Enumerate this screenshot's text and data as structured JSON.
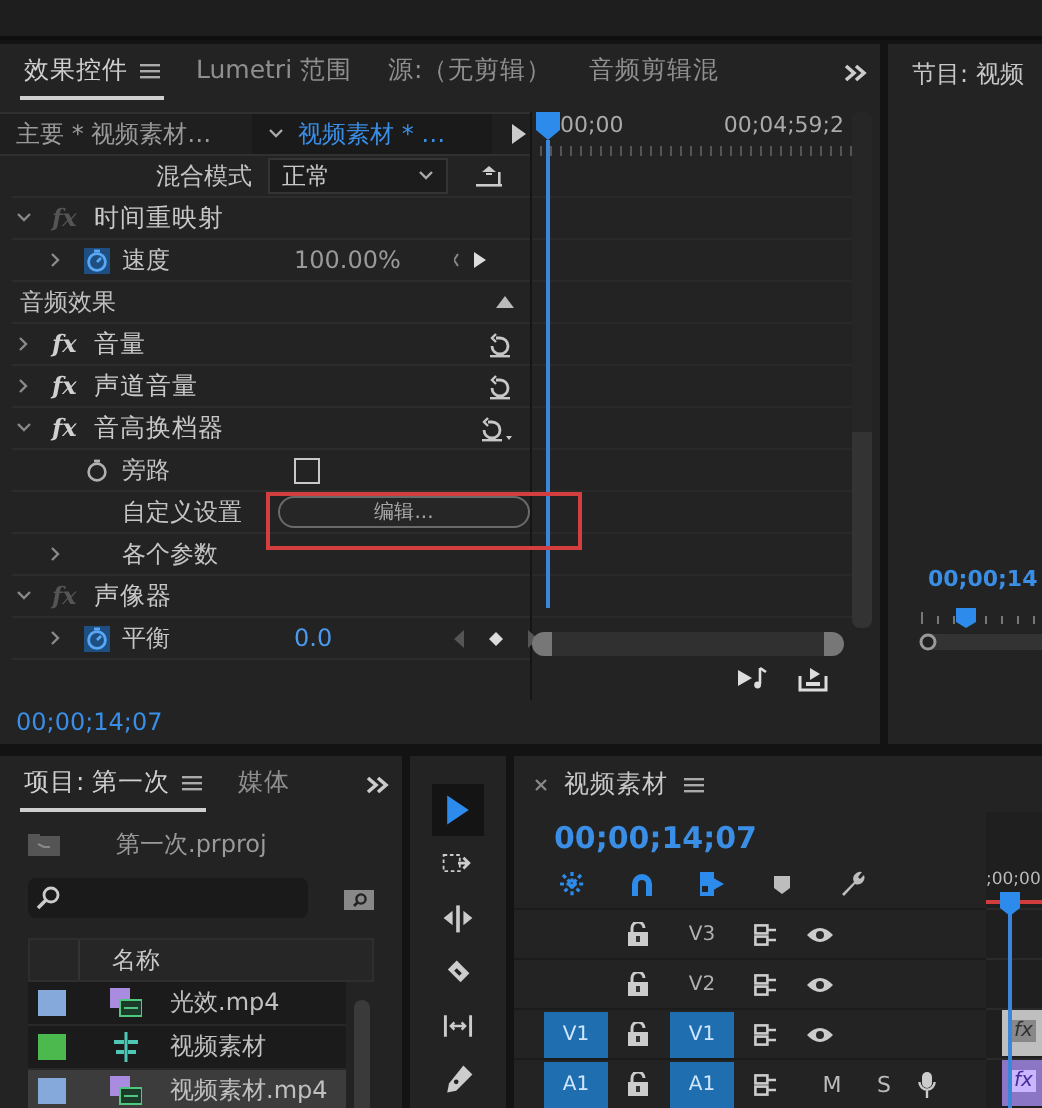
{
  "effect_controls": {
    "tabs": [
      {
        "label": "效果控件",
        "selected": true
      },
      {
        "label": "Lumetri 范围",
        "selected": false
      },
      {
        "label": "源:（无剪辑）",
        "selected": false
      },
      {
        "label": "音频剪辑混",
        "selected": false
      }
    ],
    "clip_selector": {
      "master": "主要 * 视频素材…",
      "clip": "视频素材 * …"
    },
    "ruler": {
      "start": "00;00",
      "end": "00;04;59;2"
    },
    "rows": [
      {
        "kind": "property",
        "label": "混合模式",
        "value": "正常"
      },
      {
        "kind": "effect",
        "badge": "fx",
        "fx_on": false,
        "label": "时间重映射",
        "expanded": true,
        "reset": false,
        "children": [
          {
            "kind": "param",
            "label": "速度",
            "value": "100.00%",
            "animated": true,
            "disabled": true,
            "expanded": false
          }
        ]
      },
      {
        "kind": "section",
        "label": "音频效果"
      },
      {
        "kind": "effect",
        "badge": "fx",
        "fx_on": true,
        "label": "音量",
        "expanded": false,
        "reset": true
      },
      {
        "kind": "effect",
        "badge": "fx",
        "fx_on": true,
        "label": "声道音量",
        "expanded": false,
        "reset": true
      },
      {
        "kind": "effect",
        "badge": "fx",
        "fx_on": true,
        "label": "音高换档器",
        "expanded": true,
        "reset": true,
        "children": [
          {
            "kind": "checkbox",
            "label": "旁路",
            "checked": false
          },
          {
            "kind": "button",
            "label": "自定义设置",
            "button": "编辑...",
            "highlighted": true
          },
          {
            "kind": "group",
            "label": "各个参数",
            "expanded": false
          }
        ]
      },
      {
        "kind": "effect",
        "badge": "fx",
        "fx_on": false,
        "label": "声像器",
        "expanded": true,
        "reset": false,
        "children": [
          {
            "kind": "param",
            "label": "平衡",
            "value": "0.0",
            "animated": true,
            "disabled": false,
            "expanded": false
          }
        ]
      }
    ],
    "timecode": "00;00;14;07"
  },
  "program_monitor": {
    "title": "节目: 视频",
    "timecode": "00;00;14"
  },
  "project": {
    "tabs": [
      {
        "label": "项目: 第一次",
        "selected": true
      },
      {
        "label": "媒体",
        "selected": false
      }
    ],
    "file": "第一次.prproj",
    "column": "名称",
    "items": [
      {
        "name": "光效.mp4",
        "kind": "video",
        "color": "#86a9dc",
        "selected": false
      },
      {
        "name": "视频素材",
        "kind": "sequence",
        "color": "#4cb94f",
        "selected": false
      },
      {
        "name": "视频素材.mp4",
        "kind": "video",
        "color": "#86a9dc",
        "selected": true
      }
    ]
  },
  "tools": [
    {
      "kind": "select",
      "selected": true
    },
    {
      "kind": "track-select",
      "selected": false
    },
    {
      "kind": "ripple",
      "selected": false
    },
    {
      "kind": "razor",
      "selected": false
    },
    {
      "kind": "slip",
      "selected": false
    },
    {
      "kind": "pen",
      "selected": false
    }
  ],
  "timeline": {
    "title": "视频素材",
    "timecode": "00;00;14;07",
    "ruler": ";00;00",
    "buttons": [
      {
        "kind": "nest",
        "on": true
      },
      {
        "kind": "snap",
        "on": true
      },
      {
        "kind": "linked",
        "on": true
      },
      {
        "kind": "marker"
      },
      {
        "kind": "settings"
      }
    ],
    "tracks": [
      {
        "name": "V3",
        "kind": "video",
        "targeted": false
      },
      {
        "name": "V2",
        "kind": "video",
        "targeted": false
      },
      {
        "name": "V1",
        "kind": "video",
        "targeted": true,
        "source": "V1",
        "clip": {
          "badge": "fx"
        }
      },
      {
        "name": "A1",
        "kind": "audio",
        "targeted": true,
        "source": "A1",
        "mute": "M",
        "solo": "S",
        "clip": {
          "badge": "fx"
        }
      }
    ]
  }
}
